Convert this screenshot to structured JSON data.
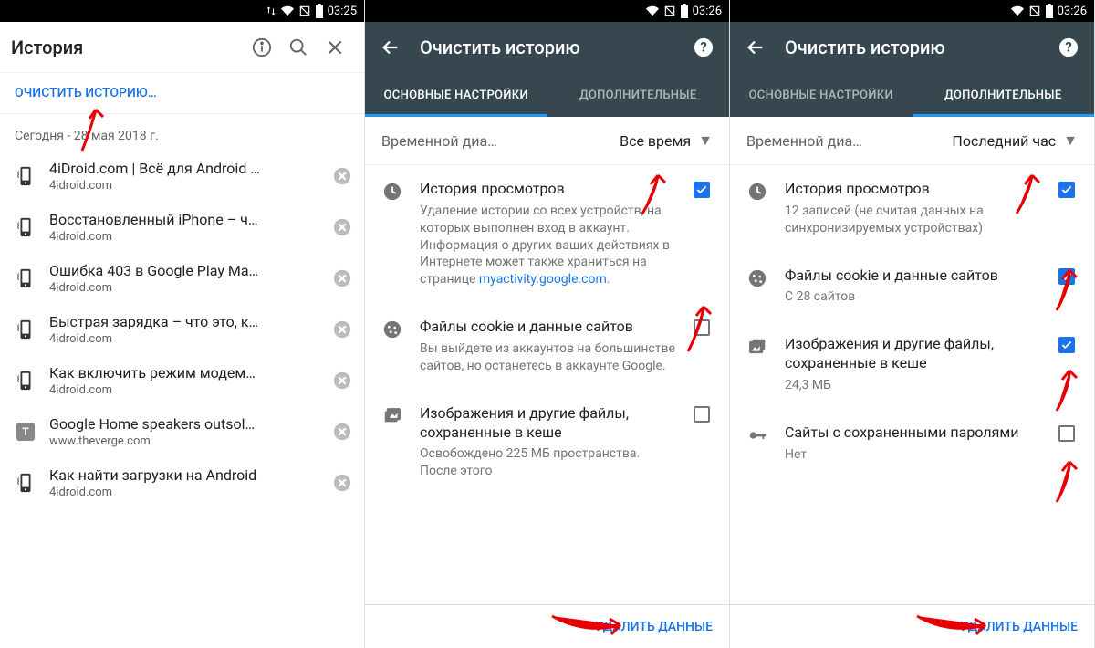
{
  "screens": {
    "s1": {
      "status_time": "03:25",
      "title": "История",
      "clear_link": "ОЧИСТИТЬ ИСТОРИЮ…",
      "date": "Сегодня - 28 мая 2018 г.",
      "items": [
        {
          "title": "4iDroid.com | Всё для Android …",
          "domain": "4idroid.com",
          "icon": "phone"
        },
        {
          "title": "Восстановленный iPhone – ч…",
          "domain": "4idroid.com",
          "icon": "phone"
        },
        {
          "title": "Ошибка 403 в Google Play Ma…",
          "domain": "4idroid.com",
          "icon": "phone"
        },
        {
          "title": "Быстрая зарядка – что это, к…",
          "domain": "4idroid.com",
          "icon": "phone"
        },
        {
          "title": "Как включить режим модем…",
          "domain": "4idroid.com",
          "icon": "phone"
        },
        {
          "title": "Google Home speakers outsol…",
          "domain": "www.theverge.com",
          "icon": "T"
        },
        {
          "title": "Как найти загрузки на Android",
          "domain": "4idroid.com",
          "icon": "phone"
        }
      ]
    },
    "s2": {
      "status_time": "03:26",
      "title": "Очистить историю",
      "tab_basic": "ОСНОВНЫЕ НАСТРОЙКИ",
      "tab_adv": "ДОПОЛНИТЕЛЬНЫЕ",
      "range_label": "Временной диа…",
      "range_value": "Все время",
      "opt1_title": "История просмотров",
      "opt1_desc": "Удаление истории со всех устройств, на которых выполнен вход в аккаунт. Информация о других ваших действиях в Интернете может также храниться на странице ",
      "opt1_link": "myactivity.google.com",
      "opt2_title": "Файлы cookie и данные сайтов",
      "opt2_desc": "Вы выйдете из аккаунтов на большинстве сайтов, но останетесь в аккаунте Google.",
      "opt3_title": "Изображения и другие файлы, сохраненные в кеше",
      "opt3_desc": "Освобождено 225 МБ пространства. После этого",
      "delete_btn": "УДАЛИТЬ ДАННЫЕ"
    },
    "s3": {
      "status_time": "03:26",
      "title": "Очистить историю",
      "tab_basic": "ОСНОВНЫЕ НАСТРОЙКИ",
      "tab_adv": "ДОПОЛНИТЕЛЬНЫЕ",
      "range_label": "Временной диа…",
      "range_value": "Последний час",
      "opt1_title": "История просмотров",
      "opt1_desc": "12 записей (не считая данных на синхронизируемых устройствах)",
      "opt2_title": "Файлы cookie и данные сайтов",
      "opt2_desc": "С 28 сайтов",
      "opt3_title": "Изображения и другие файлы, сохраненные в кеше",
      "opt3_desc": "24,3 МБ",
      "opt4_title": "Сайты с сохраненными паролями",
      "opt4_desc": "Нет",
      "delete_btn": "УДАЛИТЬ ДАННЫЕ"
    }
  }
}
